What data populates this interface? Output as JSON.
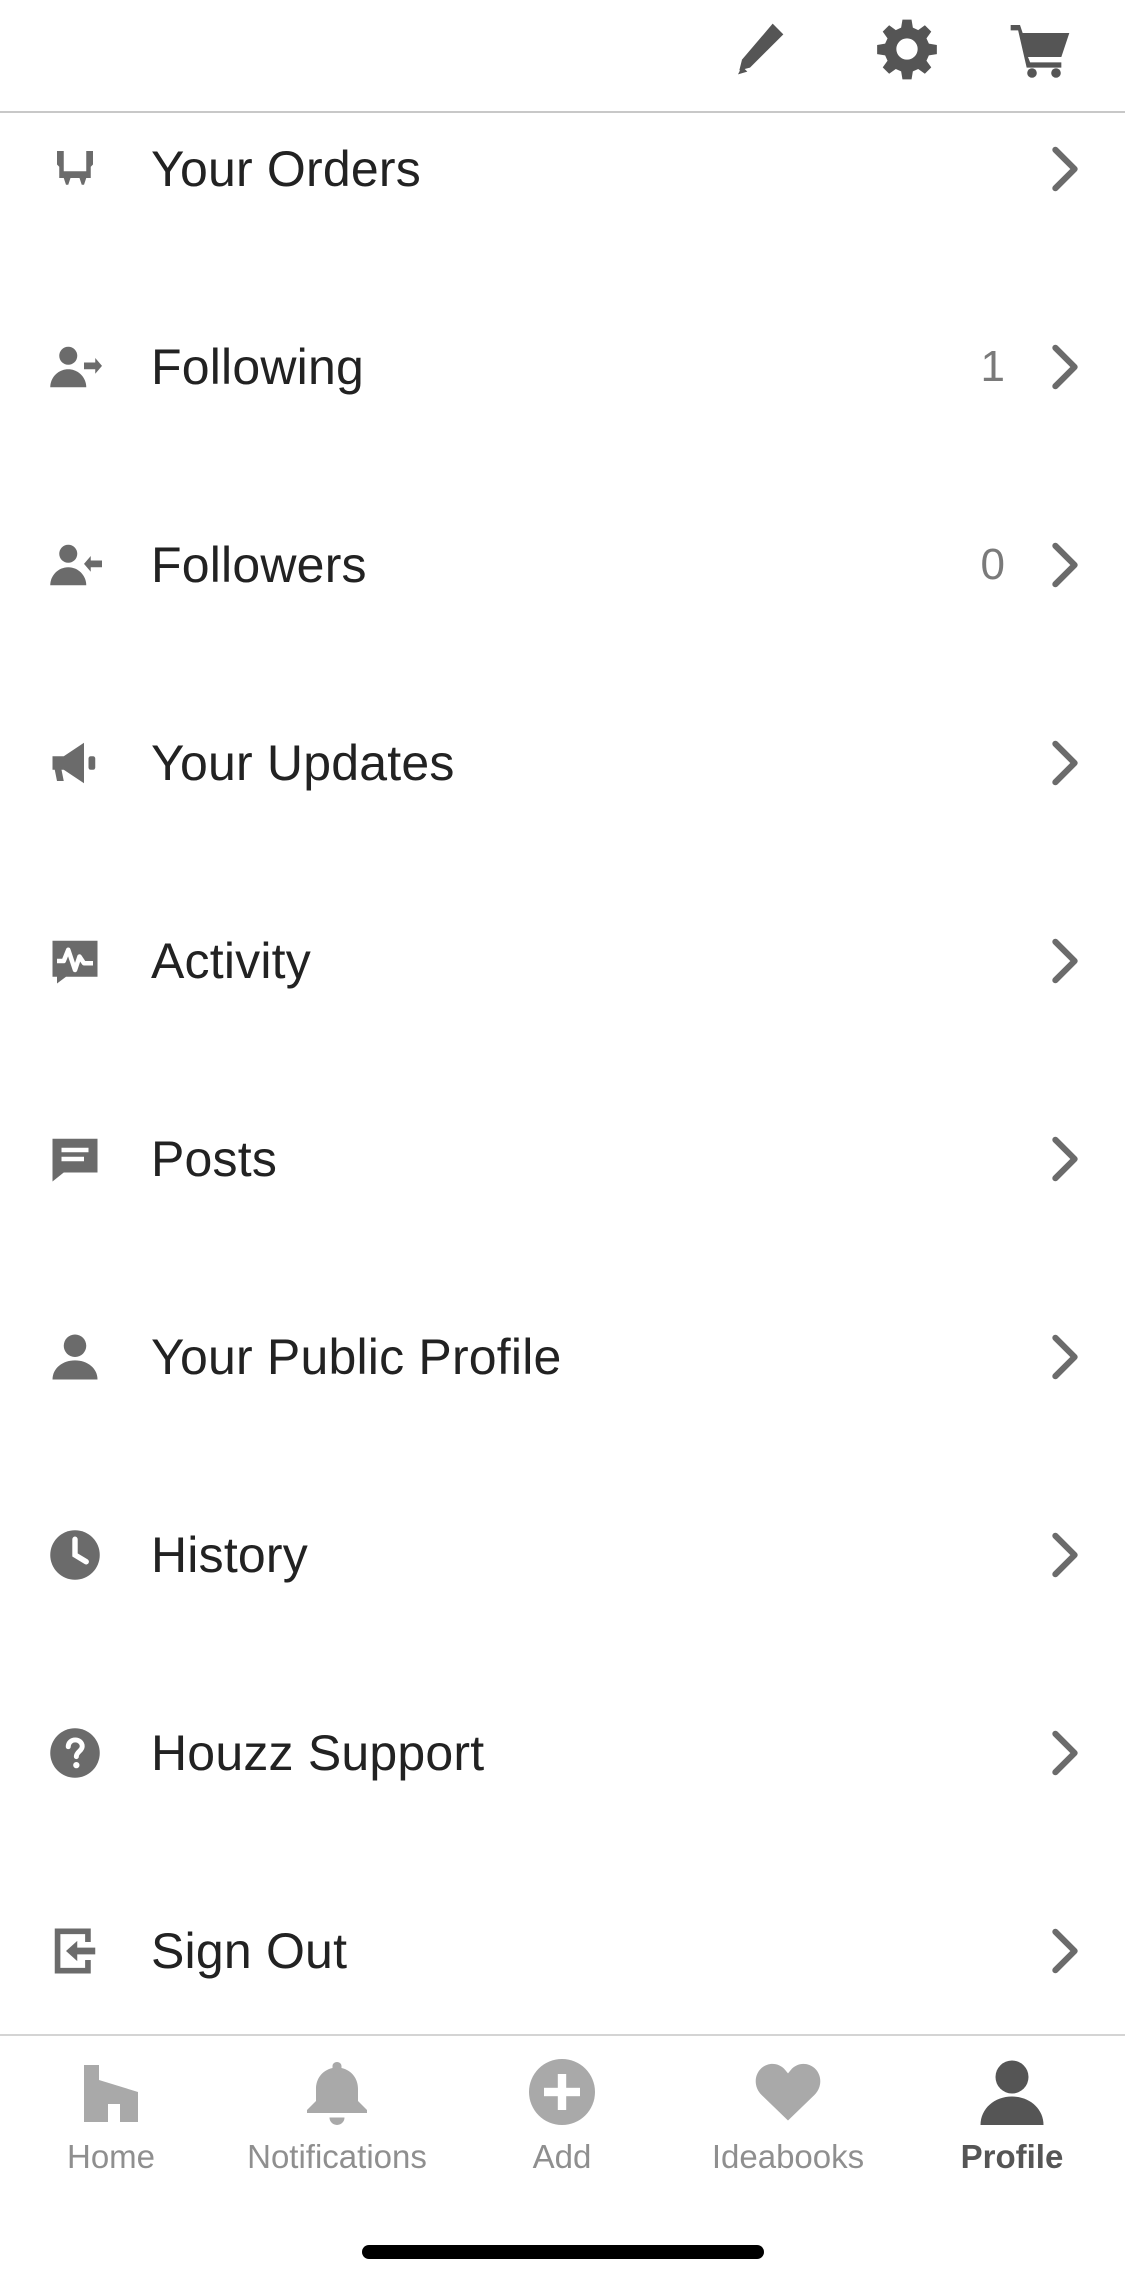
{
  "topbar": {
    "icons": [
      "pencil-icon",
      "gear-icon",
      "cart-icon"
    ]
  },
  "menu": {
    "items": [
      {
        "label": "Your Orders",
        "icon": "armchair-icon",
        "count": ""
      },
      {
        "label": "Following",
        "icon": "person-arrow-right-icon",
        "count": "1"
      },
      {
        "label": "Followers",
        "icon": "person-arrow-left-icon",
        "count": "0"
      },
      {
        "label": "Your Updates",
        "icon": "megaphone-icon",
        "count": ""
      },
      {
        "label": "Activity",
        "icon": "activity-pulse-icon",
        "count": ""
      },
      {
        "label": "Posts",
        "icon": "chat-bubble-icon",
        "count": ""
      },
      {
        "label": "Your Public Profile",
        "icon": "person-icon",
        "count": ""
      },
      {
        "label": "History",
        "icon": "clock-icon",
        "count": ""
      },
      {
        "label": "Houzz Support",
        "icon": "question-circle-icon",
        "count": ""
      },
      {
        "label": "Sign Out",
        "icon": "sign-out-icon",
        "count": ""
      }
    ],
    "chevron_icon": "chevron-right-icon"
  },
  "tabbar": {
    "tabs": [
      {
        "label": "Home",
        "icon": "house-icon",
        "active": false
      },
      {
        "label": "Notifications",
        "icon": "bell-icon",
        "active": false
      },
      {
        "label": "Add",
        "icon": "plus-circle-icon",
        "active": false
      },
      {
        "label": "Ideabooks",
        "icon": "heart-icon",
        "active": false
      },
      {
        "label": "Profile",
        "icon": "person-icon",
        "active": true
      }
    ]
  },
  "colors": {
    "icon_gray": "#6b6b6b",
    "text": "#222222",
    "inactive_tab": "#a9a9a9",
    "active_tab": "#555555",
    "divider": "#c8c8c8"
  }
}
